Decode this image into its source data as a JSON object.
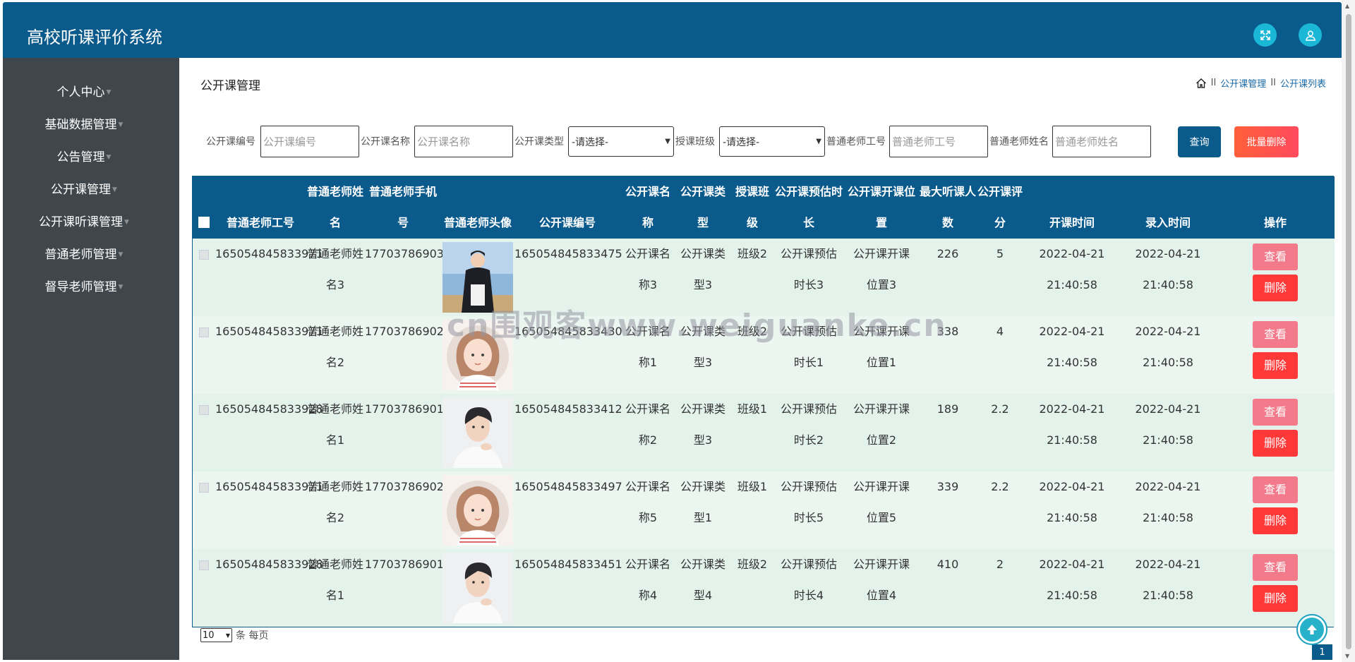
{
  "app": {
    "title": "高校听课评价系统"
  },
  "header": {
    "fullscreen_icon": "expand-icon",
    "user_icon": "user-icon",
    "accent": "#0a5a8c"
  },
  "sidebar": {
    "items": [
      {
        "label": "个人中心"
      },
      {
        "label": "基础数据管理"
      },
      {
        "label": "公告管理"
      },
      {
        "label": "公开课管理"
      },
      {
        "label": "公开课听课管理"
      },
      {
        "label": "普通老师管理"
      },
      {
        "label": "督导老师管理"
      }
    ]
  },
  "page": {
    "title": "公开课管理"
  },
  "breadcrumb": {
    "home_icon": "home-icon",
    "sep": "II",
    "level1": "公开课管理",
    "level2": "公开课列表"
  },
  "filters": {
    "code_label": "公开课编号",
    "code_placeholder": "公开课编号",
    "name_label": "公开课名称",
    "name_placeholder": "公开课名称",
    "type_label": "公开课类型",
    "type_value": "-请选择-",
    "class_label": "授课班级",
    "class_value": "-请选择-",
    "teacher_no_label": "普通老师工号",
    "teacher_no_placeholder": "普通老师工号",
    "teacher_name_label": "普通老师姓名",
    "teacher_name_placeholder": "普通老师姓名",
    "query_label": "查询",
    "bulk_delete_label": "批量删除"
  },
  "table": {
    "columns": [
      {
        "l1": "",
        "l2": "普通老师工号"
      },
      {
        "l1": "普通老师姓",
        "l2": "名"
      },
      {
        "l1": "普通老师手机",
        "l2": "号"
      },
      {
        "l1": "",
        "l2": "普通老师头像"
      },
      {
        "l1": "",
        "l2": "公开课编号"
      },
      {
        "l1": "公开课名",
        "l2": "称"
      },
      {
        "l1": "公开课类",
        "l2": "型"
      },
      {
        "l1": "授课班",
        "l2": "级"
      },
      {
        "l1": "公开课预估时",
        "l2": "长"
      },
      {
        "l1": "公开课开课位",
        "l2": "置"
      },
      {
        "l1": "最大听课人",
        "l2": "数"
      },
      {
        "l1": "公开课评",
        "l2": "分"
      },
      {
        "l1": "",
        "l2": "开课时间"
      },
      {
        "l1": "",
        "l2": "录入时间"
      },
      {
        "l1": "",
        "l2": "操作"
      }
    ],
    "view_label": "查看",
    "delete_label": "删除",
    "rows": [
      {
        "teacher_no": "165054845833971",
        "name1": "普通老师姓",
        "name2": "名3",
        "phone": "17703786903",
        "avatar": "photo-male-outdoor",
        "code": "165054845833475",
        "cname1": "公开课名",
        "cname2": "称3",
        "ctype1": "公开课类",
        "ctype2": "型3",
        "cls": "班级2",
        "dur1": "公开课预估",
        "dur2": "时长3",
        "loc1": "公开课开课",
        "loc2": "位置3",
        "max": "226",
        "score": "5",
        "start1": "2022-04-21",
        "start2": "21:40:58",
        "entry1": "2022-04-21",
        "entry2": "21:40:58"
      },
      {
        "teacher_no": "165054845833971",
        "name1": "普通老师姓",
        "name2": "名2",
        "phone": "17703786902",
        "avatar": "illustration-female",
        "code": "165054845833430",
        "cname1": "公开课名",
        "cname2": "称1",
        "ctype1": "公开课类",
        "ctype2": "型3",
        "cls": "班级2",
        "dur1": "公开课预估",
        "dur2": "时长1",
        "loc1": "公开课开课",
        "loc2": "位置1",
        "max": "338",
        "score": "4",
        "start1": "2022-04-21",
        "start2": "21:40:58",
        "entry1": "2022-04-21",
        "entry2": "21:40:58"
      },
      {
        "teacher_no": "165054845833928",
        "name1": "普通老师姓",
        "name2": "名1",
        "phone": "17703786901",
        "avatar": "photo-male-portrait",
        "code": "165054845833412",
        "cname1": "公开课名",
        "cname2": "称2",
        "ctype1": "公开课类",
        "ctype2": "型3",
        "cls": "班级1",
        "dur1": "公开课预估",
        "dur2": "时长2",
        "loc1": "公开课开课",
        "loc2": "位置2",
        "max": "189",
        "score": "2.2",
        "start1": "2022-04-21",
        "start2": "21:40:58",
        "entry1": "2022-04-21",
        "entry2": "21:40:58"
      },
      {
        "teacher_no": "165054845833971",
        "name1": "普通老师姓",
        "name2": "名2",
        "phone": "17703786902",
        "avatar": "illustration-female",
        "code": "165054845833497",
        "cname1": "公开课名",
        "cname2": "称5",
        "ctype1": "公开课类",
        "ctype2": "型1",
        "cls": "班级1",
        "dur1": "公开课预估",
        "dur2": "时长5",
        "loc1": "公开课开课",
        "loc2": "位置5",
        "max": "339",
        "score": "2.2",
        "start1": "2022-04-21",
        "start2": "21:40:58",
        "entry1": "2022-04-21",
        "entry2": "21:40:58"
      },
      {
        "teacher_no": "165054845833928",
        "name1": "普通老师姓",
        "name2": "名1",
        "phone": "17703786901",
        "avatar": "photo-male-portrait",
        "code": "165054845833451",
        "cname1": "公开课名",
        "cname2": "称4",
        "ctype1": "公开课类",
        "ctype2": "型4",
        "cls": "班级2",
        "dur1": "公开课预估",
        "dur2": "时长4",
        "loc1": "公开课开课",
        "loc2": "位置4",
        "max": "410",
        "score": "2",
        "start1": "2022-04-21",
        "start2": "21:40:58",
        "entry1": "2022-04-21",
        "entry2": "21:40:58"
      }
    ]
  },
  "pager": {
    "page_size": "10",
    "per_page_text": "条 每页",
    "current_page": "1"
  },
  "watermark": "cn围观客www.weiguanke.cn"
}
